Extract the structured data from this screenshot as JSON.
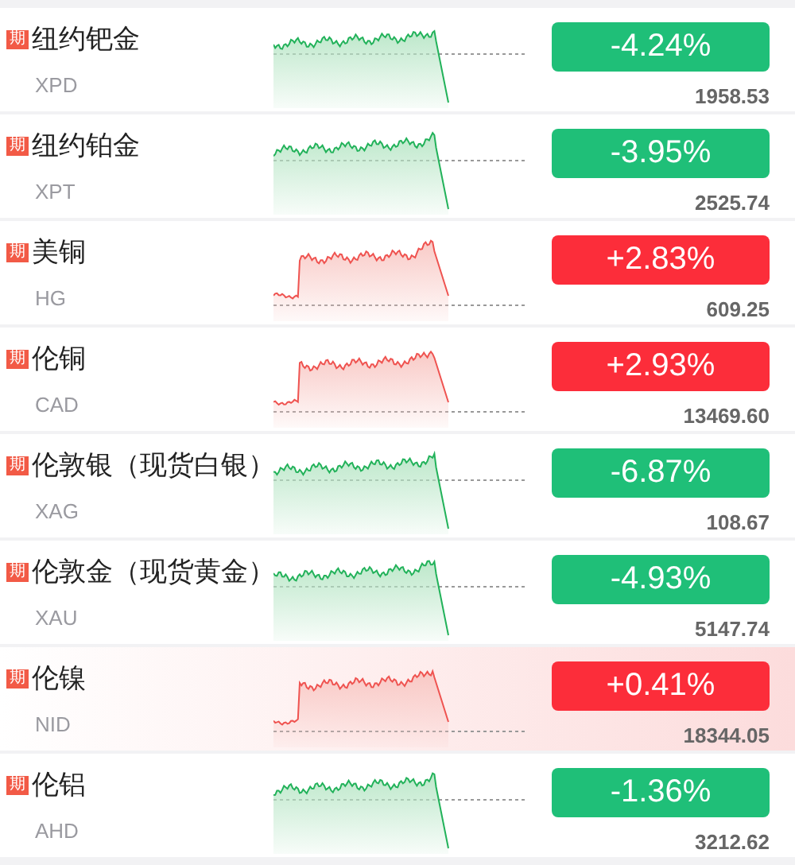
{
  "rows": [
    {
      "badge": "期",
      "name": "纽约钯金",
      "code": "XPD",
      "change": "-4.24%",
      "kind": "down",
      "price": "1958.53",
      "highlighted": false
    },
    {
      "badge": "期",
      "name": "纽约铂金",
      "code": "XPT",
      "change": "-3.95%",
      "kind": "down",
      "price": "2525.74",
      "highlighted": false
    },
    {
      "badge": "期",
      "name": "美铜",
      "code": "HG",
      "change": "+2.83%",
      "kind": "up",
      "price": "609.25",
      "highlighted": false
    },
    {
      "badge": "期",
      "name": "伦铜",
      "code": "CAD",
      "change": "+2.93%",
      "kind": "up",
      "price": "13469.60",
      "highlighted": false
    },
    {
      "badge": "期",
      "name": "伦敦银（现货白银）",
      "code": "XAG",
      "change": "-6.87%",
      "kind": "down",
      "price": "108.67",
      "highlighted": false
    },
    {
      "badge": "期",
      "name": "伦敦金（现货黄金）",
      "code": "XAU",
      "change": "-4.93%",
      "kind": "down",
      "price": "5147.74",
      "highlighted": false
    },
    {
      "badge": "期",
      "name": "伦镍",
      "code": "NID",
      "change": "+0.41%",
      "kind": "up",
      "price": "18344.05",
      "highlighted": true
    },
    {
      "badge": "期",
      "name": "伦铝",
      "code": "AHD",
      "change": "-1.36%",
      "kind": "down",
      "price": "3212.62",
      "highlighted": false
    }
  ]
}
